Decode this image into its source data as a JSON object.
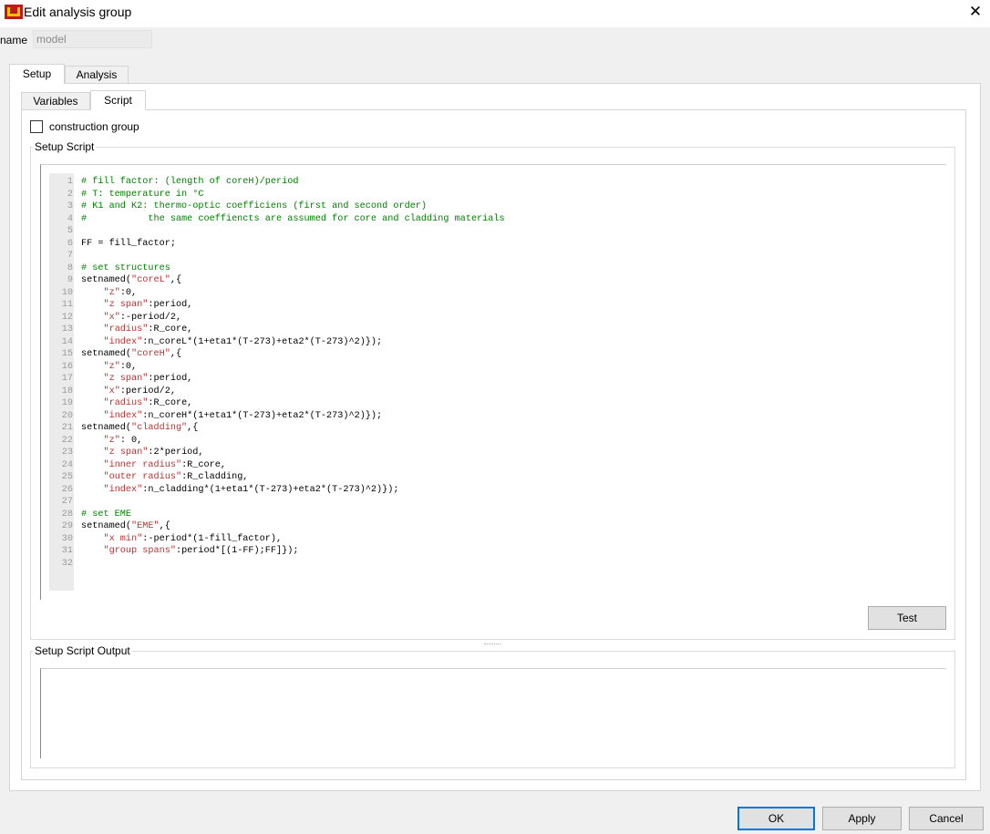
{
  "window": {
    "title": "Edit analysis group",
    "close_glyph": "✕",
    "icon": "app-logo-icon"
  },
  "name_field": {
    "label": "name",
    "value": "model"
  },
  "outer_tabs": [
    {
      "label": "Setup",
      "active": true
    },
    {
      "label": "Analysis",
      "active": false
    }
  ],
  "inner_tabs": [
    {
      "label": "Variables",
      "active": false
    },
    {
      "label": "Script",
      "active": true
    }
  ],
  "construction_group": {
    "label": "construction group",
    "checked": false
  },
  "setup_script": {
    "title": "Setup Script",
    "lines": [
      "# fill factor: (length of coreH)/period",
      "# T: temperature in °C",
      "# K1 and K2: thermo-optic coefficiens (first and second order)",
      "#           the same coeffiencts are assumed for core and cladding materials",
      "",
      "FF = fill_factor;",
      "",
      "# set structures",
      "setnamed(\"coreL\",{",
      "    \"z\":0,",
      "    \"z span\":period,",
      "    \"x\":-period/2,",
      "    \"radius\":R_core,",
      "    \"index\":n_coreL*(1+eta1*(T-273)+eta2*(T-273)^2)});",
      "setnamed(\"coreH\",{",
      "    \"z\":0,",
      "    \"z span\":period,",
      "    \"x\":period/2,",
      "    \"radius\":R_core,",
      "    \"index\":n_coreH*(1+eta1*(T-273)+eta2*(T-273)^2)});",
      "setnamed(\"cladding\",{",
      "    \"z\": 0,",
      "    \"z span\":2*period,",
      "    \"inner radius\":R_core,",
      "    \"outer radius\":R_cladding,",
      "    \"index\":n_cladding*(1+eta1*(T-273)+eta2*(T-273)^2)});",
      "",
      "# set EME",
      "setnamed(\"EME\",{",
      "    \"x min\":-period*(1-fill_factor),",
      "    \"group spans\":period*[(1-FF);FF]});",
      ""
    ],
    "test_label": "Test"
  },
  "setup_script_output": {
    "title": "Setup Script Output",
    "text": ""
  },
  "buttons": {
    "ok": "OK",
    "apply": "Apply",
    "cancel": "Cancel"
  },
  "colors": {
    "comment": "#008000",
    "string": "#c03030",
    "line_number": "#9a9a9a",
    "default_button_border": "#0078d7"
  }
}
